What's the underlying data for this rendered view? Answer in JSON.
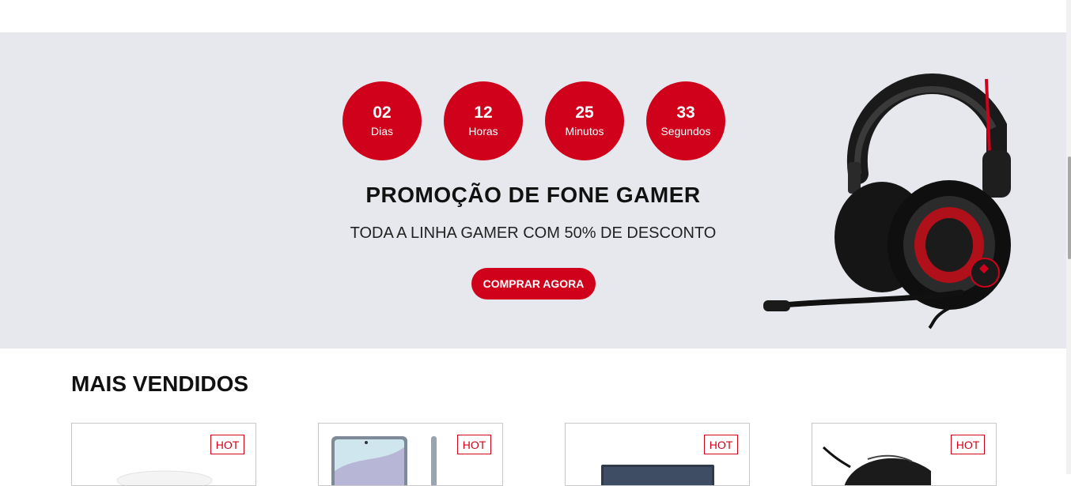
{
  "countdown": [
    {
      "value": "02",
      "label": "Dias"
    },
    {
      "value": "12",
      "label": "Horas"
    },
    {
      "value": "25",
      "label": "Minutos"
    },
    {
      "value": "33",
      "label": "Segundos"
    }
  ],
  "promo": {
    "title": "PROMOÇÃO DE FONE GAMER",
    "subtitle": "TODA A LINHA GAMER COM 50% DE DESCONTO",
    "button_label": "COMPRAR AGORA"
  },
  "best_sellers": {
    "title": "MAIS VENDIDOS",
    "products": [
      {
        "badge": "HOT",
        "image": "controller-image"
      },
      {
        "badge": "HOT",
        "image": "smartphone-image"
      },
      {
        "badge": "HOT",
        "image": "laptop-image"
      },
      {
        "badge": "HOT",
        "image": "mouse-image"
      }
    ]
  },
  "colors": {
    "accent": "#d0021b",
    "promo_bg": "#e6e8ed"
  }
}
